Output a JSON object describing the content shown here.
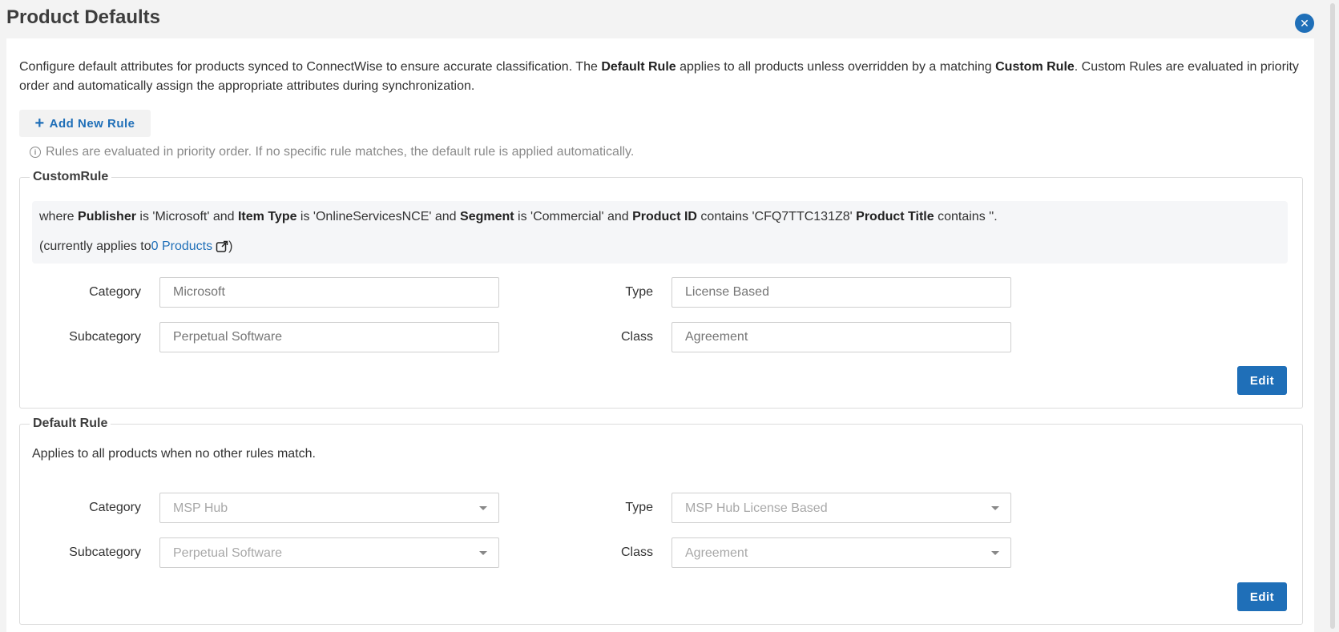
{
  "header": {
    "title": "Product Defaults",
    "close_icon": "close-icon",
    "close_glyph": "✕"
  },
  "description": {
    "part1": "Configure default attributes for products synced to ConnectWise to ensure accurate classification. The ",
    "bold1": "Default Rule",
    "part2": " applies to all products unless overridden by a matching ",
    "bold2": "Custom Rule",
    "part3": ". Custom Rules are evaluated in priority order and automatically assign the appropriate attributes during synchronization."
  },
  "add_rule": {
    "icon": "plus-icon",
    "plus": "+",
    "label": "Add New Rule"
  },
  "hint": {
    "icon": "info-icon",
    "glyph": "i",
    "text": "Rules are evaluated in priority order. If no specific rule matches, the default rule is applied automatically."
  },
  "custom_rule": {
    "legend": "CustomRule",
    "condition": {
      "t1": "where ",
      "b1": "Publisher",
      "t2": " is 'Microsoft' and ",
      "b2": "Item Type",
      "t3": " is 'OnlineServicesNCE' and ",
      "b3": "Segment",
      "t4": " is 'Commercial' and ",
      "b4": "Product ID",
      "t5": " contains 'CFQ7TTC131Z8' ",
      "b5": "Product Title",
      "t6": " contains ''."
    },
    "applies": {
      "prefix": "(currently applies to ",
      "link": "0 Products",
      "link_icon": "external-link-icon",
      "suffix": ")"
    },
    "fields": {
      "category_label": "Category",
      "category_placeholder": "Microsoft",
      "type_label": "Type",
      "type_placeholder": "License Based",
      "subcategory_label": "Subcategory",
      "subcategory_placeholder": "Perpetual Software",
      "class_label": "Class",
      "class_placeholder": "Agreement"
    },
    "edit_label": "Edit"
  },
  "default_rule": {
    "legend": "Default Rule",
    "description": "Applies to all products when no other rules match.",
    "fields": {
      "category_label": "Category",
      "category_value": "MSP Hub",
      "type_label": "Type",
      "type_value": "MSP Hub License Based",
      "subcategory_label": "Subcategory",
      "subcategory_value": "Perpetual Software",
      "class_label": "Class",
      "class_value": "Agreement"
    },
    "edit_label": "Edit"
  },
  "colors": {
    "accent": "#1f6fb8",
    "page_bg": "#f3f3f3",
    "panel_bg": "#ffffff",
    "condition_bg": "#f5f6f8"
  }
}
